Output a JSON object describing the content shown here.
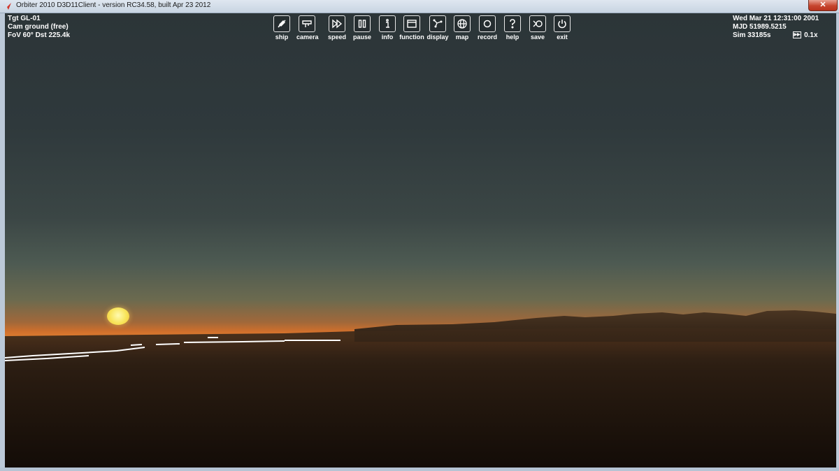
{
  "window": {
    "title": "Orbiter 2010 D3D11Client - version RC34.58, built Apr 23 2012",
    "close_label": "✕"
  },
  "hud_left": {
    "target": "Tgt   GL-01",
    "camera": "Cam  ground (free)",
    "fov": "FoV  60°   Dst 225.4k"
  },
  "hud_right": {
    "date": "Wed Mar 21 12:31:00 2001",
    "mjd": "MJD  51989.5215",
    "sim": "Sim   33185s",
    "warp": "0.1x",
    "warp_icon": "fast-forward-icon"
  },
  "toolbar": {
    "items": [
      {
        "label": "ship",
        "icon": "ship-icon"
      },
      {
        "label": "camera",
        "icon": "camera-icon"
      },
      {
        "label": "speed",
        "icon": "speed-icon"
      },
      {
        "label": "pause",
        "icon": "pause-icon"
      },
      {
        "label": "info",
        "icon": "info-icon"
      },
      {
        "label": "function",
        "icon": "function-icon"
      },
      {
        "label": "display",
        "icon": "display-icon"
      },
      {
        "label": "map",
        "icon": "map-icon"
      },
      {
        "label": "record",
        "icon": "record-icon"
      },
      {
        "label": "help",
        "icon": "help-icon"
      },
      {
        "label": "save",
        "icon": "save-icon"
      },
      {
        "label": "exit",
        "icon": "exit-icon"
      }
    ]
  },
  "colors": {
    "hud_text": "#ffffff",
    "sky_top": "#2c3538",
    "horizon": "#e07f30",
    "sun": "#f8e45a"
  }
}
